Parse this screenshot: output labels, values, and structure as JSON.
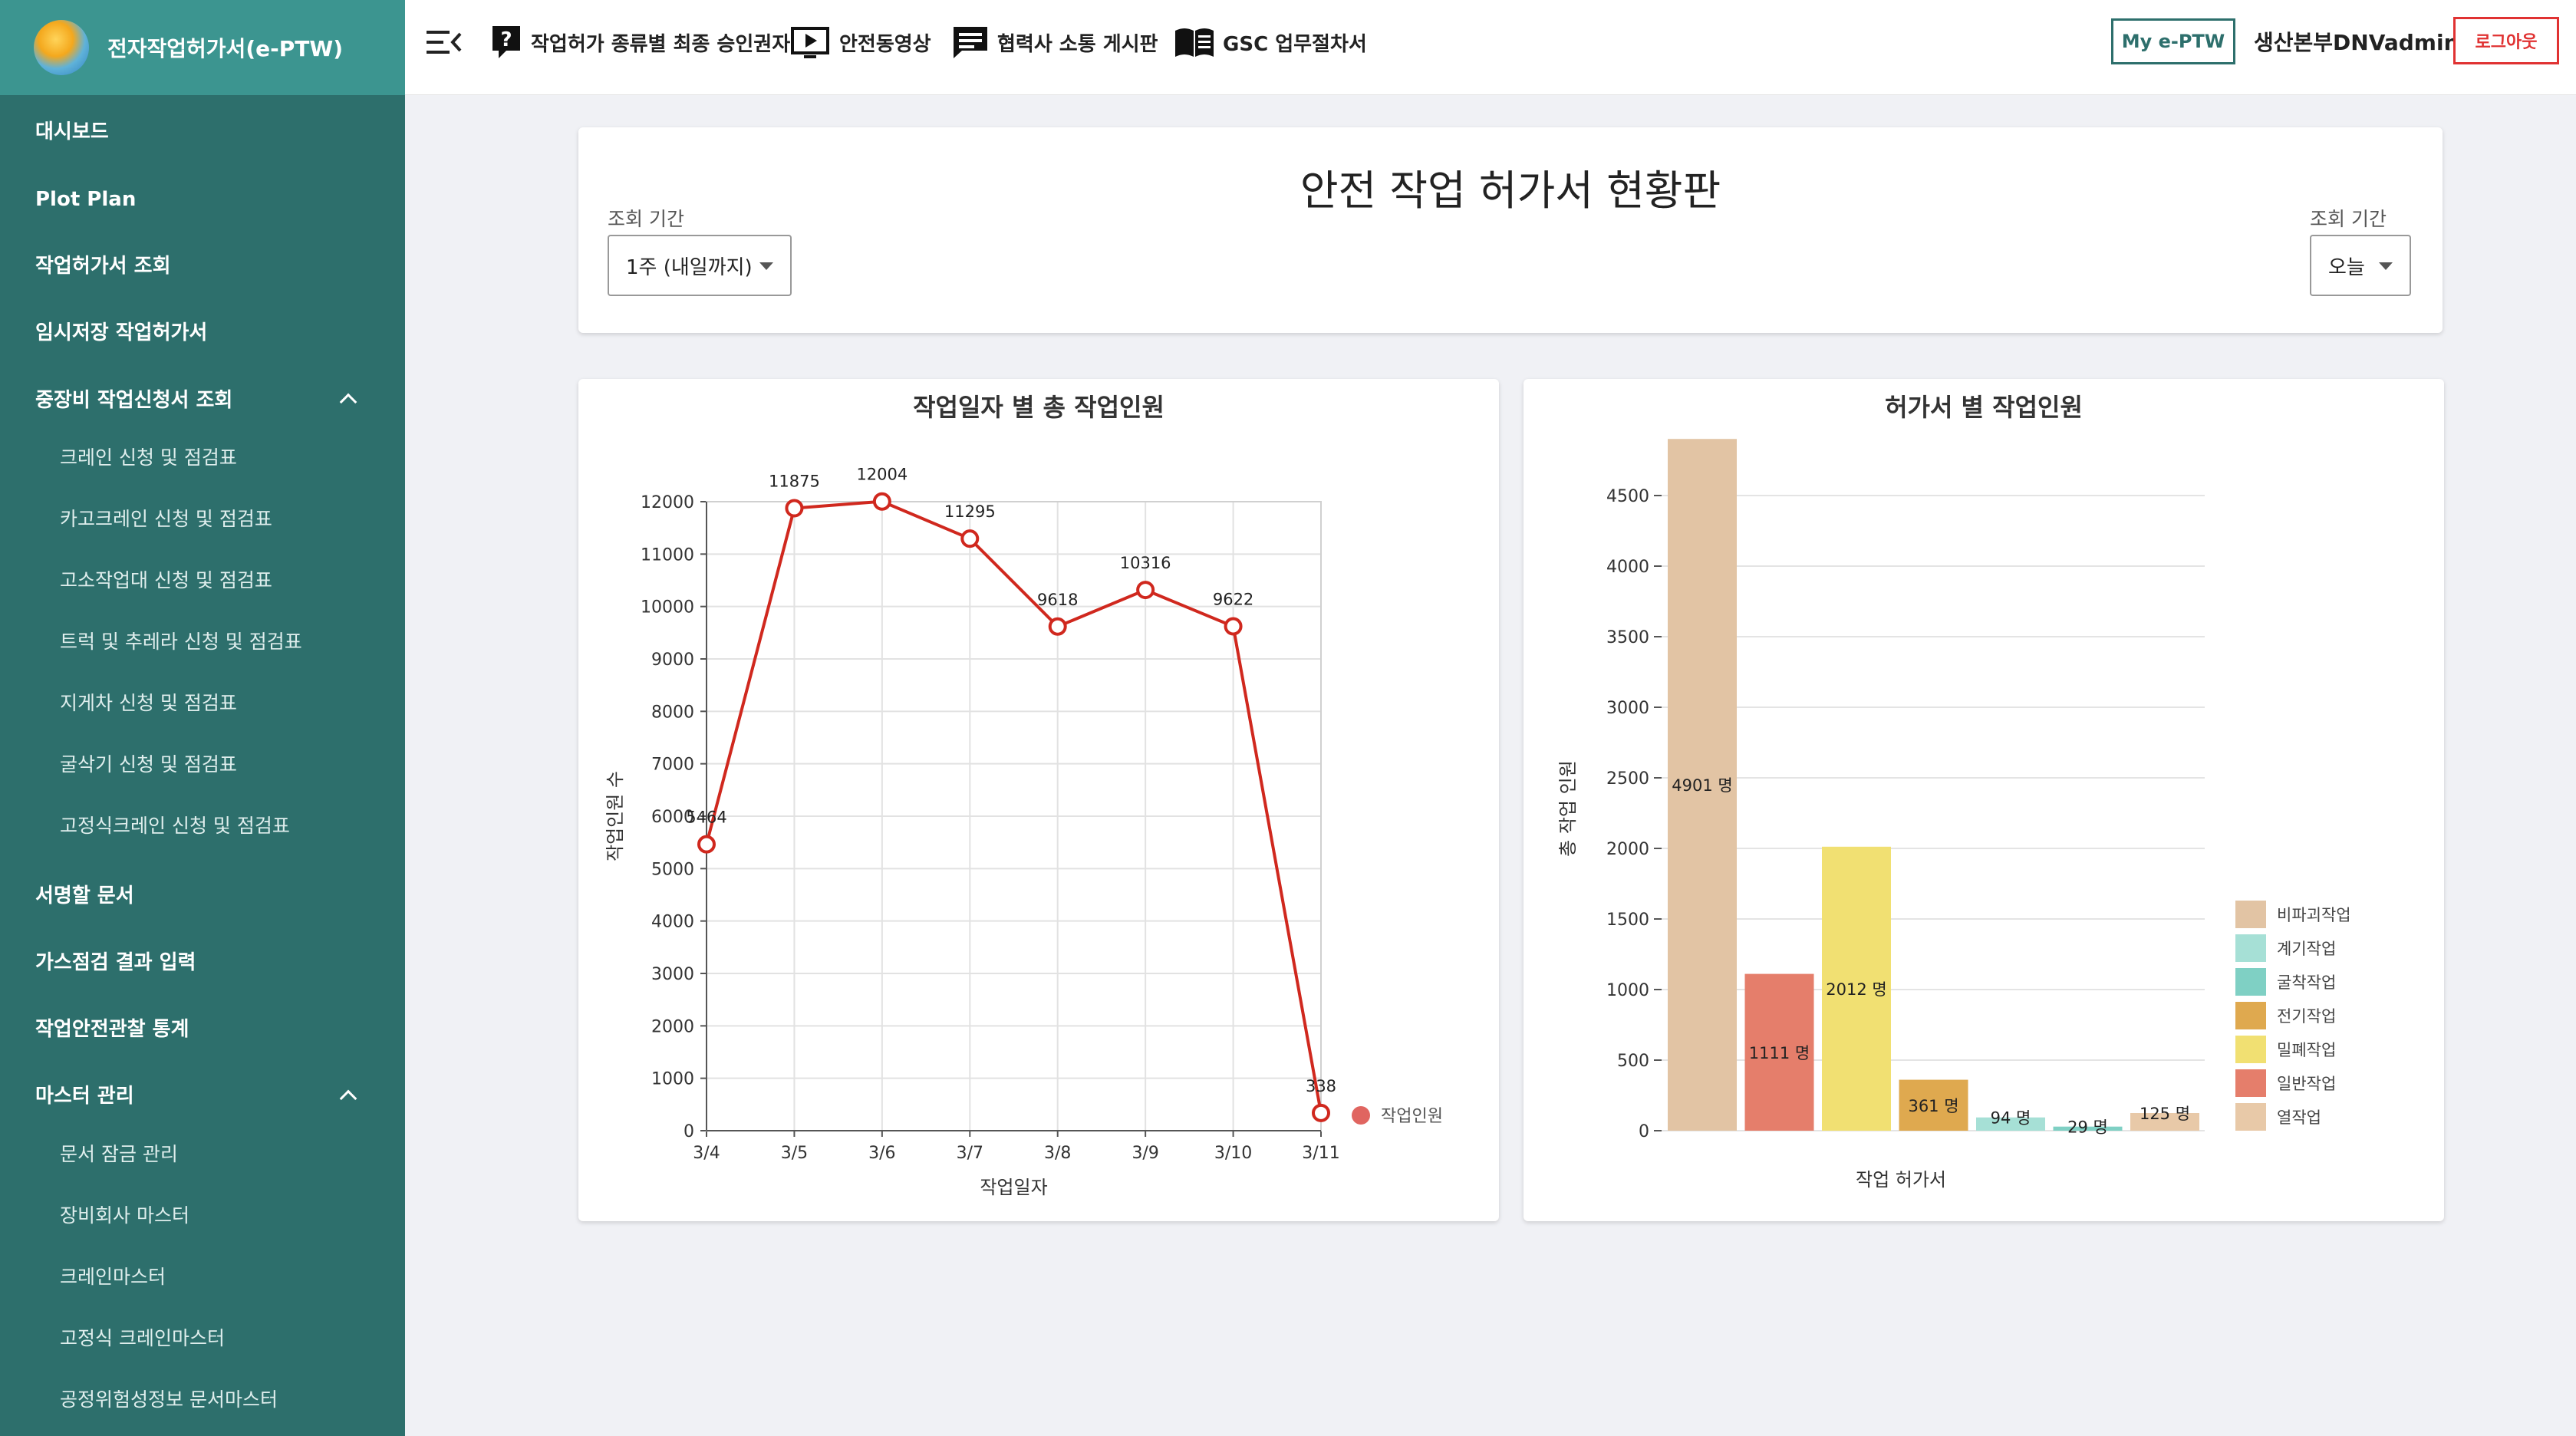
{
  "app": {
    "title": "전자작업허가서(e-PTW)"
  },
  "sidebar": {
    "items": [
      {
        "label": "대시보드"
      },
      {
        "label": "Plot Plan"
      },
      {
        "label": "작업허가서 조회"
      },
      {
        "label": "임시저장 작업허가서"
      },
      {
        "label": "중장비 작업신청서 조회"
      },
      {
        "label": "서명할 문서"
      },
      {
        "label": "가스점검 결과 입력"
      },
      {
        "label": "작업안전관찰 통계"
      },
      {
        "label": "마스터 관리"
      }
    ],
    "equipment_sub": [
      "크레인 신청 및 점검표",
      "카고크레인 신청 및 점검표",
      "고소작업대 신청 및 점검표",
      "트럭 및 추레라 신청 및 점검표",
      "지게차 신청 및 점검표",
      "굴삭기 신청 및 점검표",
      "고정식크레인 신청 및 점검표"
    ],
    "master_sub": [
      "문서 잠금 관리",
      "장비회사 마스터",
      "크레인마스터",
      "고정식 크레인마스터",
      "공정위험성정보 문서마스터"
    ]
  },
  "header": {
    "nav": [
      "작업허가 종류별 최종 승인권자",
      "안전동영상",
      "협력사 소통 게시판",
      "GSC 업무절차서"
    ],
    "my_ptw": "My e-PTW",
    "user": "생산본부DNVadmin",
    "logout": "로그아웃"
  },
  "dashboard": {
    "title": "안전 작업 허가서 현황판",
    "left_period_label": "조회 기간",
    "left_period_value": "1주 (내일까지)",
    "right_period_label": "조회 기간",
    "right_period_value": "오늘"
  },
  "chart_data": [
    {
      "type": "line",
      "title": "작업일자 별 총 작업인원",
      "xlabel": "작업일자",
      "ylabel": "작업인원 수",
      "categories": [
        "3/4",
        "3/5",
        "3/6",
        "3/7",
        "3/8",
        "3/9",
        "3/10",
        "3/11"
      ],
      "series": [
        {
          "name": "작업인원",
          "values": [
            5464,
            11875,
            12004,
            11295,
            9618,
            10316,
            9622,
            338
          ]
        }
      ],
      "ylim": [
        0,
        12000
      ],
      "yticks": [
        0,
        1000,
        2000,
        3000,
        4000,
        5000,
        6000,
        7000,
        8000,
        9000,
        10000,
        11000,
        12000
      ],
      "grid": true,
      "legend": "right",
      "color": "#d0281e"
    },
    {
      "type": "bar",
      "title": "허가서 별 작업인원",
      "xlabel": "작업 허가서",
      "ylabel": "총 작업 인원",
      "categories": [
        "비파괴작업",
        "일반작업",
        "밀폐작업",
        "전기작업",
        "계기작업",
        "굴착작업",
        "열작업"
      ],
      "values": [
        4901,
        1111,
        2012,
        361,
        94,
        29,
        125
      ],
      "data_labels": [
        "4901 명",
        "1111 명",
        "2012 명",
        "361 명",
        "94 명",
        "29 명",
        "125 명"
      ],
      "colors": [
        "#e2c4a4",
        "#e57e6b",
        "#f1e072",
        "#dfa94f",
        "#a6e0d6",
        "#7fd0c4",
        "#e8c9a8"
      ],
      "ylim": [
        0,
        4500
      ],
      "yticks": [
        0,
        500,
        1000,
        1500,
        2000,
        2500,
        3000,
        3500,
        4000,
        4500
      ],
      "legend": {
        "position": "right",
        "entries": [
          {
            "name": "비파괴작업",
            "color": "#e2c4a4"
          },
          {
            "name": "계기작업",
            "color": "#a6e0d6"
          },
          {
            "name": "굴착작업",
            "color": "#7fd0c4"
          },
          {
            "name": "전기작업",
            "color": "#dfa94f"
          },
          {
            "name": "밀폐작업",
            "color": "#f1e072"
          },
          {
            "name": "일반작업",
            "color": "#e57e6b"
          },
          {
            "name": "열작업",
            "color": "#e8c9a8"
          }
        ]
      }
    }
  ]
}
